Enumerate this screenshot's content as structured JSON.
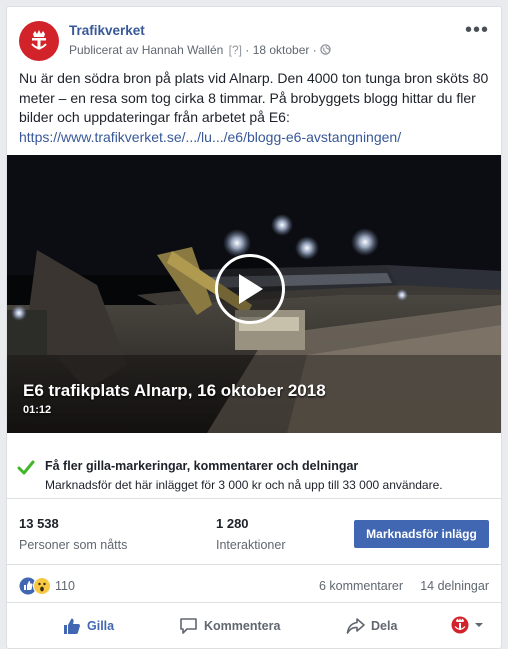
{
  "post": {
    "page_name": "Trafikverket",
    "meta_prefix": "Publicerat av Hannah Wallén",
    "meta_q": "[?]",
    "meta_sep": "·",
    "date": "18 oktober",
    "meta_sep2": "·",
    "more_label": "•••",
    "text_line": "Nu är den södra bron på plats vid Alnarp. Den 4000 ton tunga bron sköts 80 meter – en resa som tog cirka 8 timmar. På brobyggets blogg hittar du fler bilder och uppdateringar från arbetet på E6:",
    "link": "https://www.trafikverket.se/.../lu.../e6/blogg-e6-avstangningen/"
  },
  "video": {
    "title": "E6 trafikplats Alnarp, 16 oktober 2018",
    "duration": "01:12"
  },
  "promo": {
    "title": "Få fler gilla-markeringar, kommentarer och delningar",
    "subtitle": "Marknadsför det här inlägget för 3 000 kr och nå upp till 33 000 användare."
  },
  "stats": {
    "reach_value": "13 538",
    "reach_label": "Personer som nåtts",
    "interactions_value": "1 280",
    "interactions_label": "Interaktioner",
    "promote_button": "Marknadsför inlägg"
  },
  "reactions": {
    "count": "110",
    "comments": "6 kommentarer",
    "shares": "14 delningar"
  },
  "actions": {
    "like": "Gilla",
    "comment": "Kommentera",
    "share": "Dela"
  },
  "colors": {
    "brand_red": "#d2232a",
    "link_blue": "#385898",
    "button_blue": "#4267b2",
    "check_green": "#42b72a"
  },
  "icons": [
    "trafikverket-logo-icon",
    "globe-icon",
    "more-icon",
    "play-icon",
    "check-icon",
    "like-reaction-icon",
    "wow-reaction-icon",
    "thumbs-up-icon",
    "comment-icon",
    "share-icon",
    "caret-down-icon"
  ]
}
